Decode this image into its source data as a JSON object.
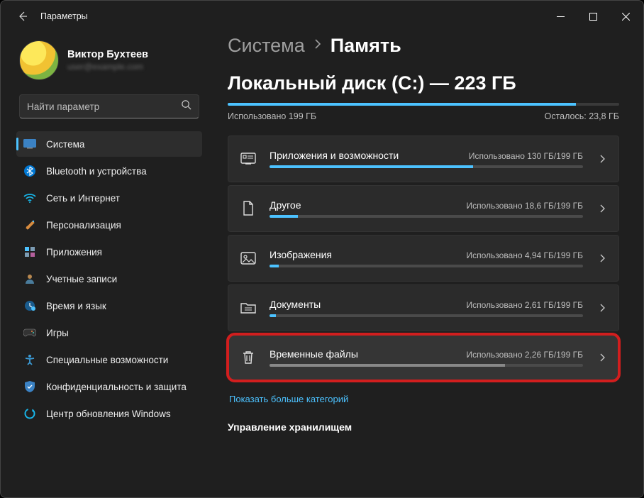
{
  "window": {
    "title": "Параметры"
  },
  "user": {
    "name": "Виктор Бухтеев",
    "email": "user@example.com"
  },
  "search": {
    "placeholder": "Найти параметр"
  },
  "nav": {
    "items": [
      {
        "label": "Система"
      },
      {
        "label": "Bluetooth и устройства"
      },
      {
        "label": "Сеть и Интернет"
      },
      {
        "label": "Персонализация"
      },
      {
        "label": "Приложения"
      },
      {
        "label": "Учетные записи"
      },
      {
        "label": "Время и язык"
      },
      {
        "label": "Игры"
      },
      {
        "label": "Специальные возможности"
      },
      {
        "label": "Конфиденциальность и защита"
      },
      {
        "label": "Центр обновления Windows"
      }
    ]
  },
  "breadcrumb": {
    "parent": "Система",
    "current": "Память"
  },
  "disk": {
    "heading": "Локальный диск (C:) — 223 ГБ",
    "used_label": "Использовано 199 ГБ",
    "free_label": "Осталось: 23,8 ГБ",
    "used_pct": 89
  },
  "categories": [
    {
      "title": "Приложения и возможности",
      "usage": "Использовано 130 ГБ/199 ГБ",
      "pct": 65
    },
    {
      "title": "Другое",
      "usage": "Использовано 18,6 ГБ/199 ГБ",
      "pct": 9
    },
    {
      "title": "Изображения",
      "usage": "Использовано 4,94 ГБ/199 ГБ",
      "pct": 3
    },
    {
      "title": "Документы",
      "usage": "Использовано 2,61 ГБ/199 ГБ",
      "pct": 2
    },
    {
      "title": "Временные файлы",
      "usage": "Использовано 2,26 ГБ/199 ГБ",
      "pct": 75,
      "highlight": true
    }
  ],
  "show_more": "Показать больше категорий",
  "section": {
    "storage_mgmt": "Управление хранилищем"
  }
}
